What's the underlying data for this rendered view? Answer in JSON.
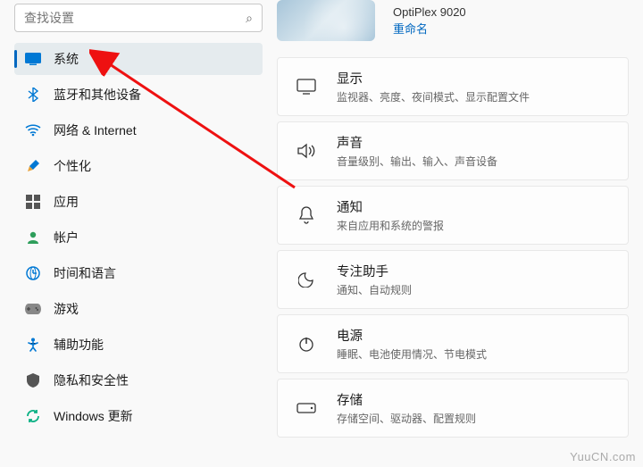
{
  "search": {
    "placeholder": "查找设置",
    "icon": "search-icon"
  },
  "sidebar": {
    "items": [
      {
        "label": "系统",
        "icon": "system-icon",
        "active": true
      },
      {
        "label": "蓝牙和其他设备",
        "icon": "bluetooth-icon"
      },
      {
        "label": "网络 & Internet",
        "icon": "wifi-icon"
      },
      {
        "label": "个性化",
        "icon": "personalize-icon"
      },
      {
        "label": "应用",
        "icon": "apps-icon"
      },
      {
        "label": "帐户",
        "icon": "account-icon"
      },
      {
        "label": "时间和语言",
        "icon": "time-language-icon"
      },
      {
        "label": "游戏",
        "icon": "gaming-icon"
      },
      {
        "label": "辅助功能",
        "icon": "accessibility-icon"
      },
      {
        "label": "隐私和安全性",
        "icon": "privacy-icon"
      },
      {
        "label": "Windows 更新",
        "icon": "update-icon"
      }
    ]
  },
  "device": {
    "model": "OptiPlex 9020",
    "rename": "重命名"
  },
  "cards": [
    {
      "icon": "display-icon",
      "title": "显示",
      "sub": "监视器、亮度、夜间模式、显示配置文件"
    },
    {
      "icon": "sound-icon",
      "title": "声音",
      "sub": "音量级别、输出、输入、声音设备"
    },
    {
      "icon": "notifications-icon",
      "title": "通知",
      "sub": "来自应用和系统的警报"
    },
    {
      "icon": "focus-assist-icon",
      "title": "专注助手",
      "sub": "通知、自动规则"
    },
    {
      "icon": "power-icon",
      "title": "电源",
      "sub": "睡眠、电池使用情况、节电模式"
    },
    {
      "icon": "storage-icon",
      "title": "存储",
      "sub": "存储空间、驱动器、配置规则"
    }
  ],
  "watermark": "YuuCN.com"
}
